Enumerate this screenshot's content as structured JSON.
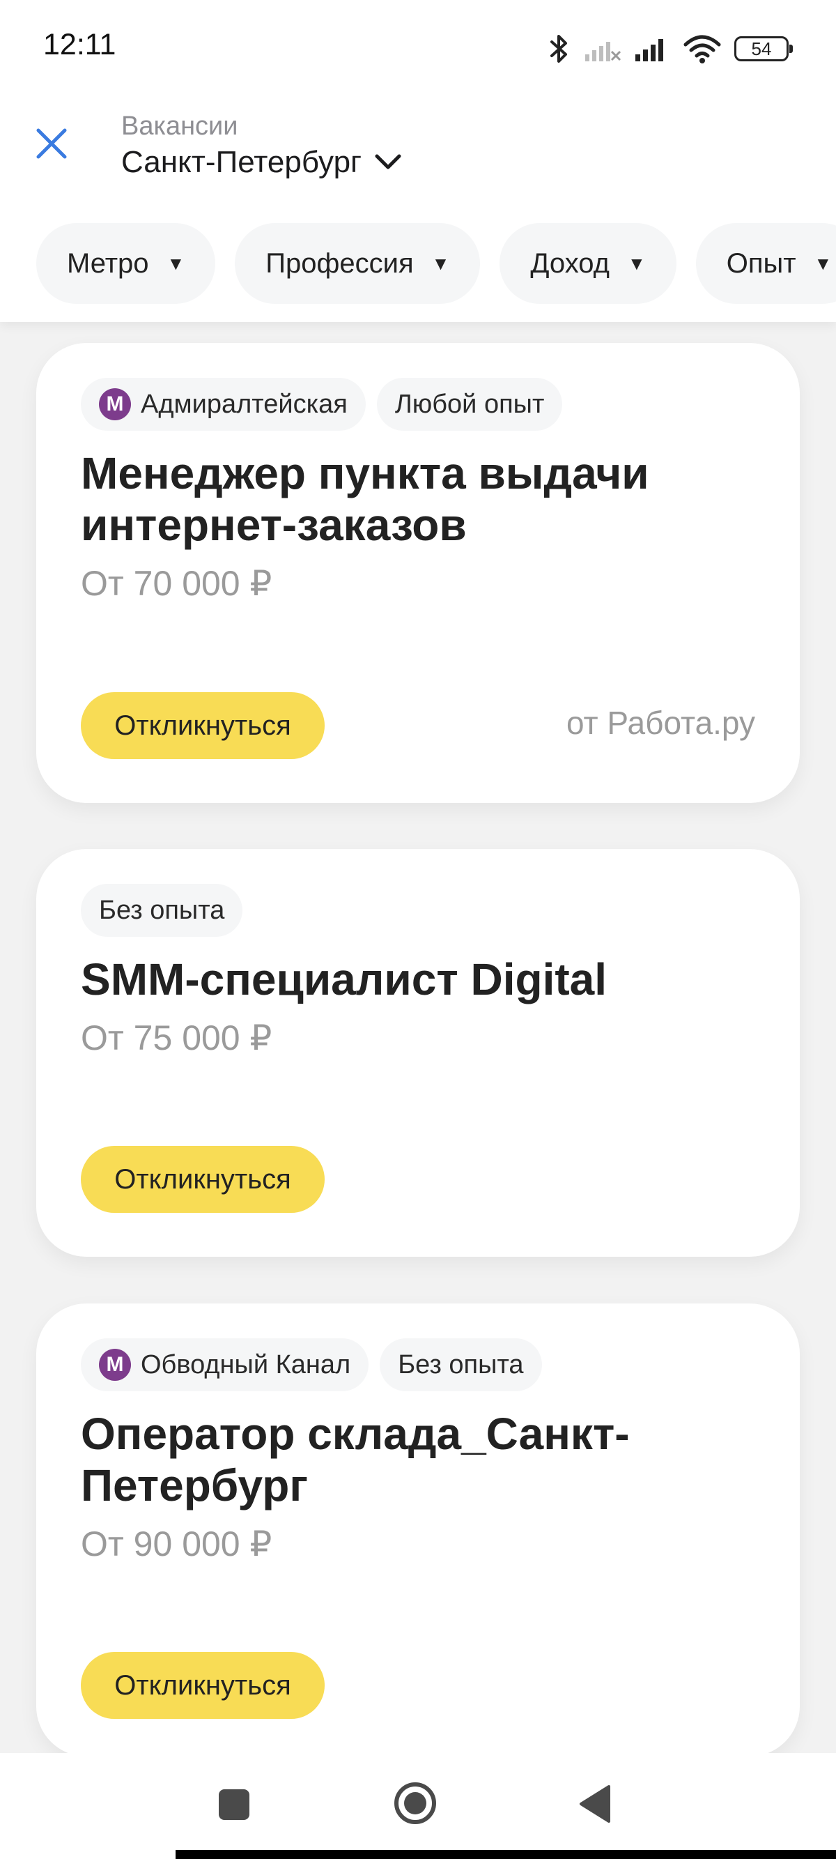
{
  "status_bar": {
    "time": "12:11",
    "battery": "54",
    "icons": [
      "bluetooth-icon",
      "signal-none-icon",
      "signal-icon",
      "wifi-icon",
      "battery-icon"
    ]
  },
  "header": {
    "subtitle": "Вакансии",
    "city": "Санкт-Петербург"
  },
  "filters": [
    "Метро",
    "Профессия",
    "Доход",
    "Опыт"
  ],
  "colors": {
    "accent_yellow": "#f8dc55",
    "metro_purple": "#7d3c8c",
    "close_blue": "#3a7be0"
  },
  "jobs": [
    {
      "metro": "Адмиралтейская",
      "experience": "Любой опыт",
      "title": "Менеджер пункта выдачи интернет-заказов",
      "salary": "От 70 000 ₽",
      "apply_label": "Откликнуться",
      "source": "от Работа.ру"
    },
    {
      "experience": "Без опыта",
      "title": "SMM-специалист Digital",
      "salary": "От 75 000 ₽",
      "apply_label": "Откликнуться"
    },
    {
      "metro": "Обводный Канал",
      "experience": "Без опыта",
      "title": "Оператор склада_Санкт-Петербург",
      "salary": "От 90 000 ₽",
      "apply_label": "Откликнуться"
    }
  ],
  "metro_letter": "М",
  "nav": [
    "recent-apps-icon",
    "home-icon",
    "back-icon"
  ]
}
